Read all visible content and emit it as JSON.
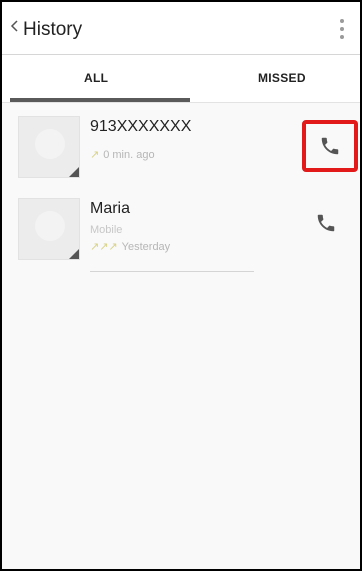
{
  "header": {
    "title": "History",
    "back_icon": "chevron-left-icon",
    "overflow_icon": "overflow-menu-icon"
  },
  "tabs": [
    {
      "label": "ALL",
      "active": true
    },
    {
      "label": "MISSED",
      "active": false
    }
  ],
  "calls": [
    {
      "name": "913XXXXXXX",
      "subtitle": "",
      "type_icon": "outgoing-call-icon",
      "time": "0 min. ago",
      "action_icon": "phone-icon",
      "highlighted": true
    },
    {
      "name": "Maria",
      "subtitle": "Mobile",
      "type_icon": "outgoing-call-icon",
      "time": "Yesterday",
      "action_icon": "phone-icon",
      "highlighted": false
    }
  ],
  "colors": {
    "highlight": "#e21a1a",
    "tab_indicator": "#5a5a5a",
    "phone_icon": "#555555"
  }
}
